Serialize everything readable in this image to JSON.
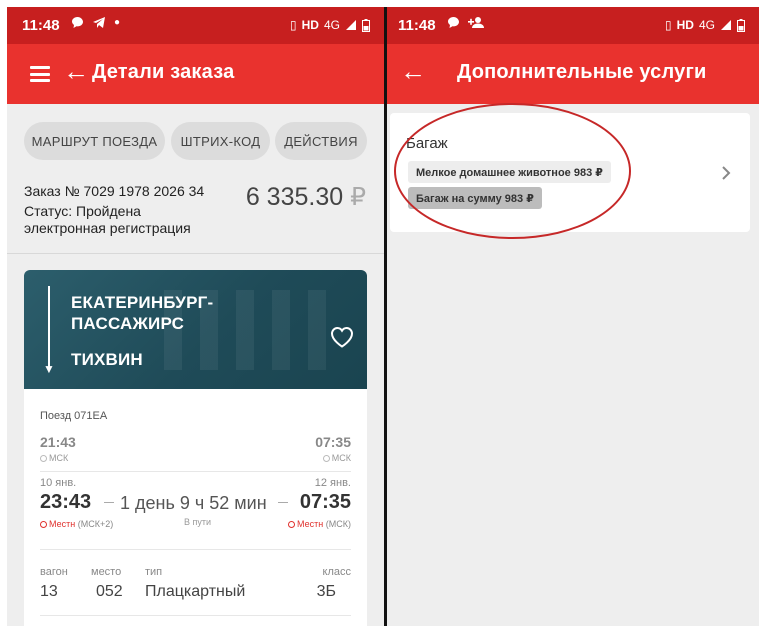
{
  "left_screen": {
    "status_bar": {
      "time": "11:48",
      "network": "HD",
      "signal": "4G"
    },
    "app_bar": {
      "title": "Детали заказа"
    },
    "chips": [
      {
        "label": "МАРШРУТ ПОЕЗДА"
      },
      {
        "label": "ШТРИХ-КОД"
      },
      {
        "label": "ДЕЙСТВИЯ"
      }
    ],
    "order": {
      "number": "Заказ № 7029 1978 2026 34",
      "status_line1": "Статус: Пройдена",
      "status_line2": "электронная регистрация",
      "price": "6 335.30",
      "currency": "₽"
    },
    "ticket": {
      "from": "ЕКАТЕРИНБУРГ-ПАССАЖИРС",
      "to": "ТИХВИН",
      "train": "Поезд 071ЕА",
      "departure_msk": "21:43",
      "arrival_msk": "07:35",
      "tz_msk": "МСК",
      "departure_date": "10 янв.",
      "arrival_date": "12 янв.",
      "departure_local": "23:43",
      "arrival_local": "07:35",
      "duration": "1 день 9 ч 52 мин",
      "in_way": "В пути",
      "local_label": "Местн",
      "departure_tz": "(МСК+2)",
      "arrival_tz": "(МСК)",
      "car_label": "вагон",
      "car_value": "13",
      "seat_label": "место",
      "seat_value": "052",
      "type_label": "тип",
      "type_value": "Плацкартный",
      "class_label": "класс",
      "class_value": "3Б"
    }
  },
  "right_screen": {
    "status_bar": {
      "time": "11:48",
      "network": "HD",
      "signal": "4G"
    },
    "app_bar": {
      "title": "Дополнительные услуги"
    },
    "service": {
      "title": "Багаж",
      "tag1": "Мелкое домашнее животное 983 ₽",
      "tag2": "Багаж на сумму 983 ₽"
    }
  },
  "colors": {
    "status_bar": "#c71f1f",
    "app_bar": "#e9322e",
    "ticket_header": "#245664",
    "annotation": "#c62828"
  }
}
